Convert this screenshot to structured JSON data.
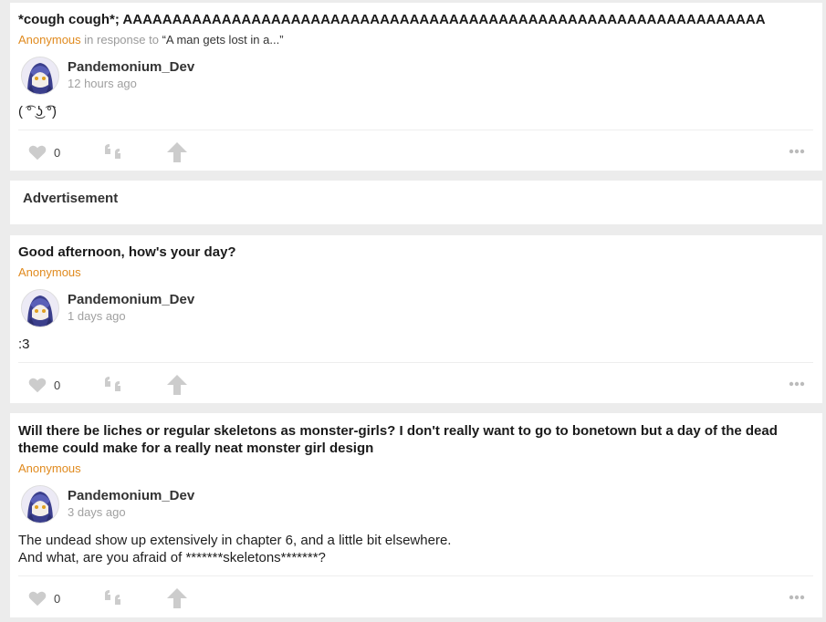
{
  "colors": {
    "accent": "#e08a1e",
    "muted": "#a0a0a0",
    "icon": "#cccccc"
  },
  "posts": [
    {
      "question": "*cough cough*; AAAAAAAAAAAAAAAAAAAAAAAAAAAAAAAAAAAAAAAAAAAAAAAAAAAAAAAAAAAAAAAAA",
      "asker": "Anonymous",
      "in_response_to": "in response to",
      "response_quote": "“A man gets lost in a...”",
      "author": "Pandemonium_Dev",
      "time": "12 hours ago",
      "answer_lines": [
        "( ͡° ͜ʖ ͡°)"
      ],
      "likes": "0"
    },
    {
      "question": "Good afternoon, how's your day?",
      "asker": "Anonymous",
      "author": "Pandemonium_Dev",
      "time": "1 days ago",
      "answer_lines": [
        ":3"
      ],
      "likes": "0"
    },
    {
      "question": "Will there be liches or regular skeletons as monster-girls? I don't really want to go to bonetown but a day of the dead theme could make for a really neat monster girl design",
      "asker": "Anonymous",
      "author": "Pandemonium_Dev",
      "time": "3 days ago",
      "answer_lines": [
        "The undead show up extensively in chapter 6, and a little bit elsewhere.",
        "And what, are you afraid of *******skeletons*******?"
      ],
      "likes": "0"
    }
  ],
  "advertisement": {
    "label": "Advertisement"
  },
  "icons": {
    "like": "heart-icon",
    "quote": "quote-icon",
    "share": "share-arrow-icon",
    "more": "more-dots-icon"
  }
}
